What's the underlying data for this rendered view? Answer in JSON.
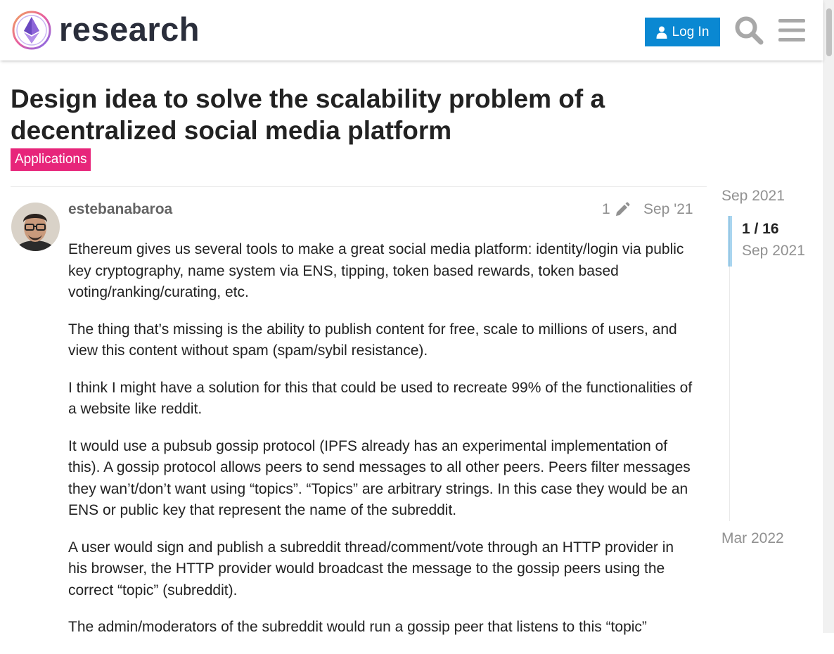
{
  "header": {
    "site_name": "research",
    "login_label": "Log In",
    "accent_color": "#0a88d2"
  },
  "topic": {
    "title": "Design idea to solve the scalability problem of a decentralized social media platform",
    "category": "Applications",
    "category_color": "#e7257a"
  },
  "post": {
    "username": "estebanabaroa",
    "edit_count": "1",
    "date": "Sep '21",
    "paragraphs": [
      "Ethereum gives us several tools to make a great social media platform: identity/login via public key cryptography, name system via ENS, tipping, token based rewards, token based voting/ranking/curating, etc.",
      "The thing that’s missing is the ability to publish content for free, scale to millions of users, and view this content without spam (spam/sybil resistance).",
      "I think I might have a solution for this that could be used to recreate 99% of the functionalities of a website like reddit.",
      "It would use a pubsub gossip protocol (IPFS already has an experimental implementation of this). A gossip protocol allows peers to send messages to all other peers. Peers filter messages they wan’t/don’t want using “topics”. “Topics” are arbitrary strings. In this case they would be an ENS or public key that represent the name of the subreddit.",
      "A user would sign and publish a subreddit thread/comment/vote through an HTTP provider in his browser, the HTTP provider would broadcast the message to the gossip peers using the correct “topic” (subreddit).",
      "The admin/moderators of the subreddit would run a gossip peer that listens to this “topic”"
    ]
  },
  "timeline": {
    "start_date": "Sep 2021",
    "position": "1 / 16",
    "position_date": "Sep 2021",
    "end_date": "Mar 2022"
  },
  "icons": {
    "login": "user-icon",
    "search": "search-icon",
    "menu": "hamburger-menu-icon",
    "edit": "pencil-icon"
  }
}
